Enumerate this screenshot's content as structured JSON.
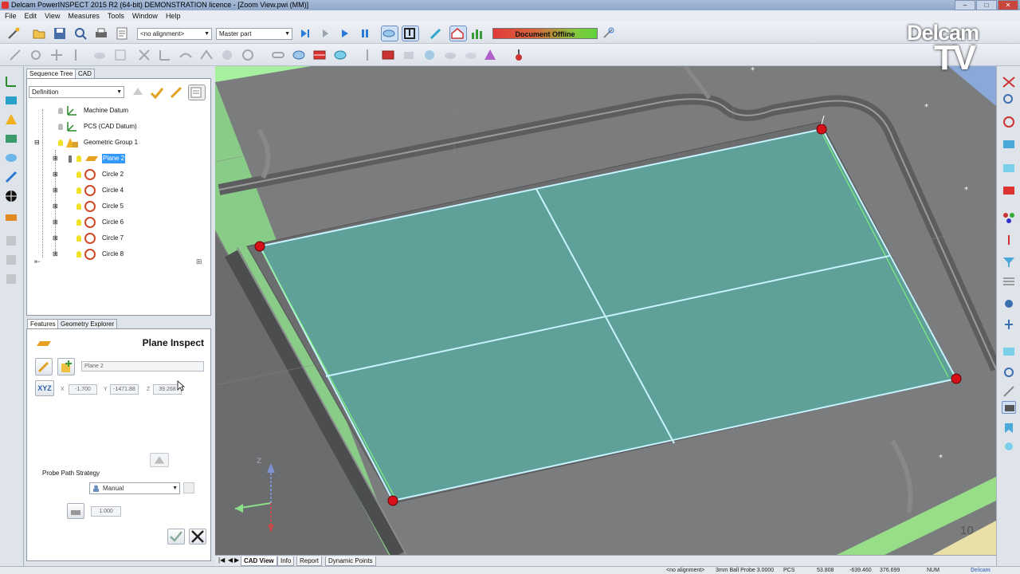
{
  "window": {
    "title": "Delcam PowerINSPECT 2015 R2 (64-bit) DEMONSTRATION licence - [Zoom View.pwi (MM)]",
    "min": "–",
    "max": "□",
    "close": "✕"
  },
  "menu": [
    "File",
    "Edit",
    "View",
    "Measures",
    "Tools",
    "Window",
    "Help"
  ],
  "toolbar": {
    "alignment_combo": "<no alignment>",
    "part_combo": "Master part",
    "document_status": "Document Offline",
    "status_colors": {
      "offline_start": "#e03a3a",
      "offline_end": "#5fd43a"
    }
  },
  "logo": {
    "line1": "Delcam",
    "line2": "TV"
  },
  "left_panel": {
    "tabs": [
      "Sequence Tree",
      "CAD"
    ],
    "definition_combo": "Definition",
    "tree": [
      {
        "label": "Machine Datum",
        "icon": "datum-axes-icon"
      },
      {
        "label": "PCS (CAD Datum)",
        "icon": "datum-axes-icon"
      },
      {
        "label": "Geometric Group 1",
        "icon": "geometric-group-icon"
      },
      {
        "label": "Plane 2",
        "icon": "plane-icon",
        "selected": true
      },
      {
        "label": "Circle 2",
        "icon": "circle-feature-icon"
      },
      {
        "label": "Circle 4",
        "icon": "circle-feature-icon"
      },
      {
        "label": "Circle 5",
        "icon": "circle-feature-icon"
      },
      {
        "label": "Circle 6",
        "icon": "circle-feature-icon"
      },
      {
        "label": "Circle 7",
        "icon": "circle-feature-icon"
      },
      {
        "label": "Circle 8",
        "icon": "circle-feature-icon"
      }
    ],
    "lower_tabs": [
      "Features",
      "Geometry Explorer"
    ],
    "inspect": {
      "title": "Plane Inspect",
      "name_field": "Plane 2",
      "xyz_button": "XYZ",
      "x_label": "X",
      "x_value": "-1.700",
      "y_label": "Y",
      "y_value": "-1471.88",
      "z_label": "Z",
      "z_value": "39.268",
      "probe_path_label": "Probe Path Strategy",
      "probe_path_value": "Manual",
      "spacing_value": "1.000"
    }
  },
  "viewport": {
    "overlay_number": "10",
    "plane_color": "#5fa39a",
    "accent_green": "#9ef08a"
  },
  "view_tabs": [
    "CAD View",
    "Info",
    "Report",
    "Dynamic Points"
  ],
  "status_bar": {
    "alignment": "<no alignment>",
    "probe": "3mm Ball Probe 3.0000",
    "pcs": "PCS",
    "x": "53.808",
    "y": "-639.460",
    "z": "376.699",
    "num": "NUM",
    "brand": "Delcam"
  }
}
